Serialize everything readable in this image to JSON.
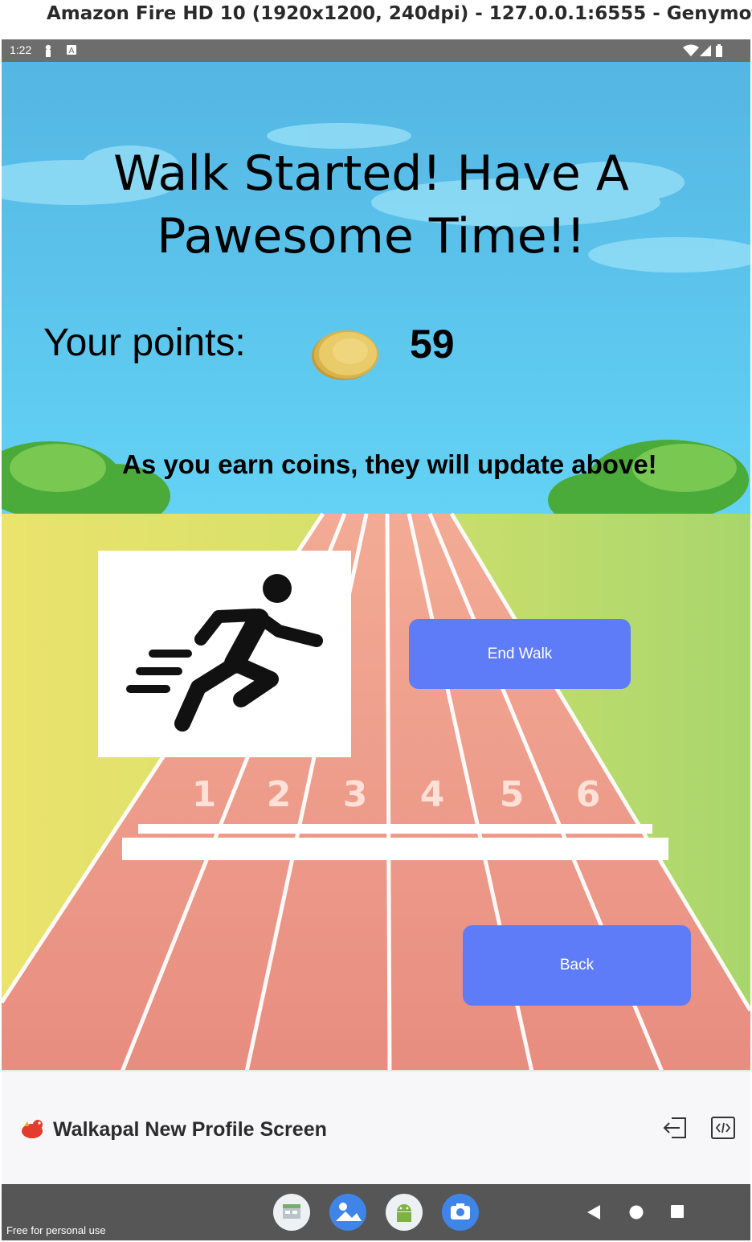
{
  "window": {
    "title": "Amazon Fire HD 10 (1920x1200, 240dpi) - 127.0.0.1:6555 - Genymot"
  },
  "statusbar": {
    "time": "1:22"
  },
  "screen": {
    "headline": "Walk Started! Have A Pawesome Time!!",
    "points_label": "Your points:",
    "points_value": "59",
    "hint": "As you earn coins, they will update above!",
    "end_walk_label": "End Walk",
    "back_label": "Back",
    "track_lane_numbers": [
      "1",
      "2",
      "3",
      "4",
      "5",
      "6"
    ]
  },
  "recorder": {
    "screen_name": "Walkapal New Profile Screen"
  },
  "navbar": {
    "watermark": "Free for personal use"
  },
  "colors": {
    "button": "#5e7cf7",
    "sky": "#5cc8ee",
    "track": "#ef9f8a",
    "grass": "#c5dc6a"
  }
}
